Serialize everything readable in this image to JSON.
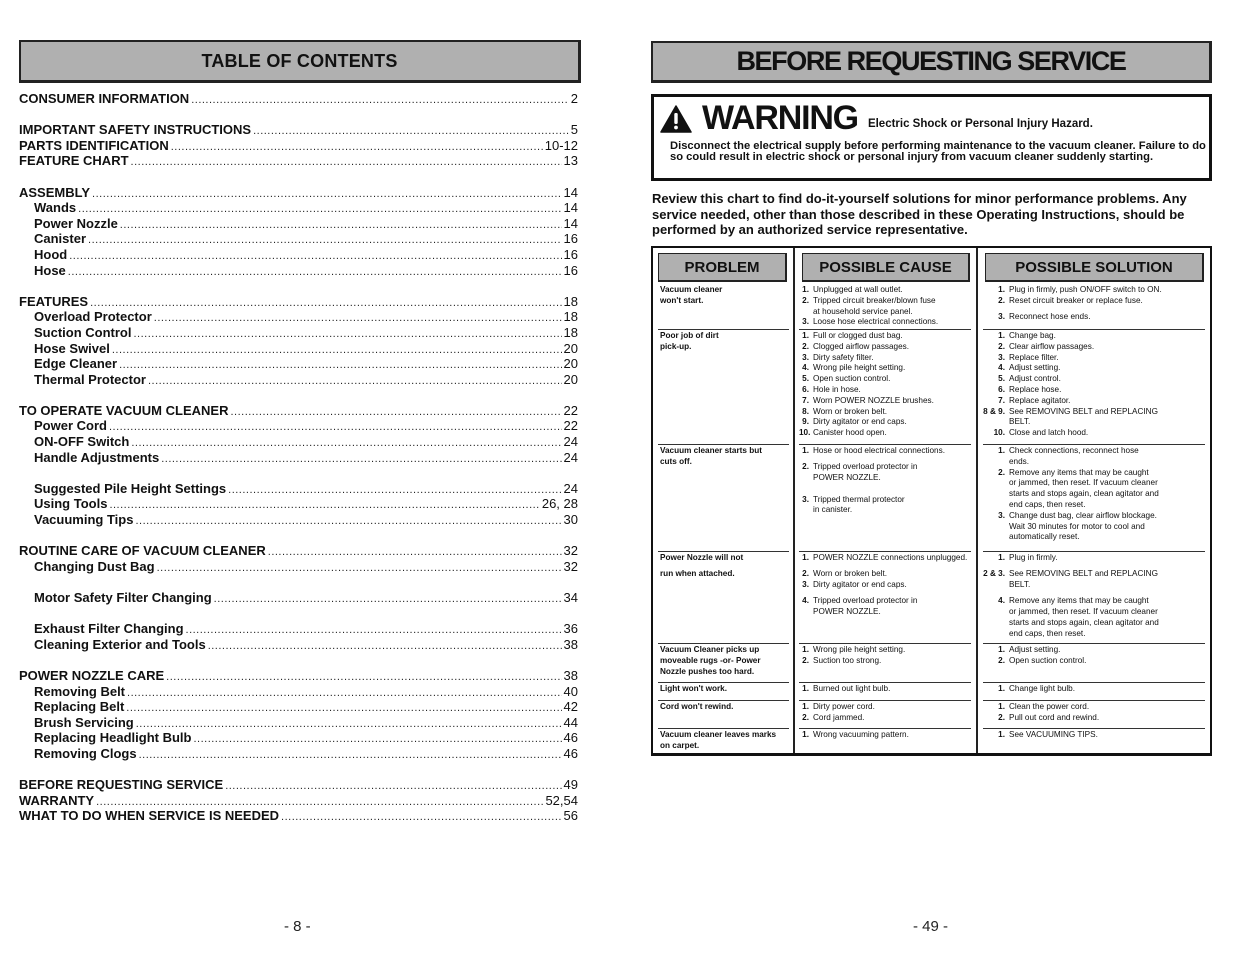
{
  "left_page": {
    "title": "TABLE OF CONTENTS",
    "entries": [
      {
        "label": "CONSUMER INFORMATION",
        "page": "2",
        "level": 0,
        "gap": false
      },
      {
        "label": "IMPORTANT SAFETY INSTRUCTIONS",
        "page": "5",
        "level": 0,
        "gap": true
      },
      {
        "label": "PARTS IDENTIFICATION",
        "page": "10-12",
        "level": 0,
        "gap": false
      },
      {
        "label": "FEATURE CHART",
        "page": "13",
        "level": 0,
        "gap": false
      },
      {
        "label": "ASSEMBLY",
        "page": "14",
        "level": 0,
        "gap": true
      },
      {
        "label": "Wands",
        "page": "14",
        "level": 1,
        "gap": false
      },
      {
        "label": "Power Nozzle",
        "page": "14",
        "level": 1,
        "gap": false
      },
      {
        "label": "Canister",
        "page": "16",
        "level": 1,
        "gap": false
      },
      {
        "label": "Hood",
        "page": "16",
        "level": 1,
        "gap": false
      },
      {
        "label": "Hose",
        "page": "16",
        "level": 1,
        "gap": false
      },
      {
        "label": "FEATURES",
        "page": "18",
        "level": 0,
        "gap": true
      },
      {
        "label": "Overload Protector",
        "page": "18",
        "level": 1,
        "gap": false
      },
      {
        "label": "Suction Control",
        "page": "18",
        "level": 1,
        "gap": false
      },
      {
        "label": "Hose Swivel",
        "page": "20",
        "level": 1,
        "gap": false
      },
      {
        "label": "Edge Cleaner",
        "page": "20",
        "level": 1,
        "gap": false
      },
      {
        "label": "Thermal Protector",
        "page": "20",
        "level": 1,
        "gap": false
      },
      {
        "label": "TO OPERATE VACUUM CLEANER",
        "page": "22",
        "level": 0,
        "gap": true
      },
      {
        "label": "Power Cord",
        "page": "22",
        "level": 1,
        "gap": false
      },
      {
        "label": "ON-OFF Switch",
        "page": "24",
        "level": 1,
        "gap": false
      },
      {
        "label": "Handle Adjustments",
        "page": "24",
        "level": 1,
        "gap": false
      },
      {
        "label": "Suggested Pile Height Settings",
        "page": "24",
        "level": 1,
        "gap": true
      },
      {
        "label": "Using Tools",
        "page": "26, 28",
        "level": 1,
        "gap": false
      },
      {
        "label": "Vacuuming Tips",
        "page": "30",
        "level": 1,
        "gap": false
      },
      {
        "label": "ROUTINE CARE OF VACUUM CLEANER",
        "page": "32",
        "level": 0,
        "gap": true
      },
      {
        "label": "Changing Dust Bag",
        "page": "32",
        "level": 1,
        "gap": false
      },
      {
        "label": "Motor Safety Filter Changing",
        "page": "34",
        "level": 1,
        "gap": true
      },
      {
        "label": "Exhaust Filter Changing",
        "page": "36",
        "level": 1,
        "gap": true
      },
      {
        "label": "Cleaning Exterior and Tools",
        "page": "38",
        "level": 1,
        "gap": false
      },
      {
        "label": "POWER NOZZLE CARE",
        "page": "38",
        "level": 0,
        "gap": true
      },
      {
        "label": "Removing Belt",
        "page": "40",
        "level": 1,
        "gap": false
      },
      {
        "label": "Replacing Belt",
        "page": "42",
        "level": 1,
        "gap": false
      },
      {
        "label": "Brush Servicing",
        "page": "44",
        "level": 1,
        "gap": false
      },
      {
        "label": "Replacing Headlight Bulb",
        "page": "46",
        "level": 1,
        "gap": false
      },
      {
        "label": "Removing Clogs",
        "page": "46",
        "level": 1,
        "gap": false
      },
      {
        "label": "BEFORE REQUESTING SERVICE",
        "page": "49",
        "level": 0,
        "gap": true
      },
      {
        "label": "WARRANTY",
        "page": "52,54",
        "level": 0,
        "gap": false
      },
      {
        "label": "WHAT TO DO WHEN SERVICE IS NEEDED",
        "page": "56",
        "level": 0,
        "gap": false
      }
    ],
    "page_number": "- 8 -"
  },
  "right_page": {
    "title": "BEFORE REQUESTING SERVICE",
    "warning": {
      "icon": "warning-triangle-icon",
      "word": "WARNING",
      "subtitle": "Electric Shock or Personal Injury Hazard.",
      "body": "Disconnect the electrical supply before performing maintenance to the vacuum cleaner. Failure to do so could result in electric shock or personal injury from vacuum cleaner suddenly starting."
    },
    "intro": "Review this chart to find do-it-yourself solutions for minor performance problems. Any service needed, other than those described in these Operating Instructions, should be performed by an authorized service representative.",
    "table": {
      "headers": [
        "PROBLEM",
        "POSSIBLE CAUSE",
        "POSSIBLE SOLUTION"
      ],
      "rows": [
        {
          "problem": [
            "Vacuum cleaner",
            "won't start."
          ],
          "causes": [
            {
              "n": "1.",
              "t": [
                "Unplugged at wall outlet."
              ]
            },
            {
              "n": "2.",
              "t": [
                "Tripped circuit breaker/blown fuse",
                "at household service panel."
              ]
            },
            {
              "n": "3.",
              "t": [
                "Loose hose electrical connections."
              ]
            }
          ],
          "solutions": [
            {
              "n": "1.",
              "t": [
                "Plug in firmly, push ON/OFF switch to ON."
              ]
            },
            {
              "n": "2.",
              "t": [
                "Reset circuit breaker or replace fuse."
              ],
              "after_gap": 1
            },
            {
              "n": "3.",
              "t": [
                "Reconnect hose ends."
              ]
            }
          ]
        },
        {
          "problem": [
            "Poor job of dirt",
            "pick-up."
          ],
          "causes": [
            {
              "n": "1.",
              "t": [
                "Full or clogged dust bag."
              ]
            },
            {
              "n": "2.",
              "t": [
                "Clogged airflow passages."
              ]
            },
            {
              "n": "3.",
              "t": [
                "Dirty safety filter."
              ]
            },
            {
              "n": "4.",
              "t": [
                "Wrong pile height setting."
              ]
            },
            {
              "n": "5.",
              "t": [
                "Open suction control."
              ]
            },
            {
              "n": "6.",
              "t": [
                "Hole in hose."
              ]
            },
            {
              "n": "7.",
              "t": [
                "Worn POWER NOZZLE brushes."
              ]
            },
            {
              "n": "8.",
              "t": [
                "Worn or broken belt."
              ]
            },
            {
              "n": "9.",
              "t": [
                "Dirty agitator or end caps."
              ]
            },
            {
              "n": "10.",
              "t": [
                "Canister hood open."
              ]
            }
          ],
          "solutions": [
            {
              "n": "1.",
              "t": [
                "Change bag."
              ]
            },
            {
              "n": "2.",
              "t": [
                "Clear airflow passages."
              ]
            },
            {
              "n": "3.",
              "t": [
                "Replace filter."
              ]
            },
            {
              "n": "4.",
              "t": [
                "Adjust setting."
              ]
            },
            {
              "n": "5.",
              "t": [
                "Adjust control."
              ]
            },
            {
              "n": "6.",
              "t": [
                "Replace hose."
              ]
            },
            {
              "n": "7.",
              "t": [
                "Replace agitator."
              ]
            },
            {
              "n": "8 & 9.",
              "t": [
                "See REMOVING BELT and REPLACING",
                "BELT."
              ]
            },
            {
              "n": "10.",
              "t": [
                "Close and latch hood."
              ]
            }
          ]
        },
        {
          "problem": [
            "Vacuum cleaner starts but",
            "cuts off."
          ],
          "causes": [
            {
              "n": "1.",
              "t": [
                "Hose or hood electrical connections."
              ],
              "after_gap": 1
            },
            {
              "n": "2.",
              "t": [
                "Tripped overload protector in",
                "POWER NOZZLE."
              ],
              "after_gap": 2
            },
            {
              "n": "3.",
              "t": [
                "Tripped thermal protector",
                "in canister."
              ]
            }
          ],
          "solutions": [
            {
              "n": "1.",
              "t": [
                "Check connections, reconnect hose",
                "ends."
              ]
            },
            {
              "n": "2.",
              "t": [
                "Remove any items that may be caught",
                "or jammed, then reset.  If vacuum cleaner",
                "starts and stops again, clean agitator and",
                "end caps, then reset."
              ]
            },
            {
              "n": "3.",
              "t": [
                "Change dust bag, clear airflow blockage.",
                "Wait 30 minutes for motor to cool and",
                "automatically reset."
              ]
            }
          ]
        },
        {
          "problem": [
            "Power Nozzle will not",
            "",
            "run when attached."
          ],
          "causes": [
            {
              "n": "1.",
              "t": [
                "POWER NOZZLE connections unplugged."
              ],
              "after_gap": 1
            },
            {
              "n": "2.",
              "t": [
                "Worn or broken belt."
              ]
            },
            {
              "n": "3.",
              "t": [
                "Dirty agitator or end caps."
              ],
              "after_gap": 1
            },
            {
              "n": "4.",
              "t": [
                "Tripped overload protector in",
                "POWER NOZZLE."
              ]
            }
          ],
          "solutions": [
            {
              "n": "1.",
              "t": [
                "Plug in firmly."
              ],
              "after_gap": 1
            },
            {
              "n": "2 & 3.",
              "t": [
                "See REMOVING BELT and REPLACING",
                "BELT."
              ],
              "after_gap": 1
            },
            {
              "n": "4.",
              "t": [
                "Remove any items that may be caught",
                "or jammed, then reset.  If vacuum cleaner",
                "starts and stops again, clean agitator and",
                "end caps, then reset."
              ]
            }
          ]
        },
        {
          "problem": [
            "Vacuum Cleaner picks up",
            "moveable rugs -or- Power",
            "Nozzle pushes too hard."
          ],
          "causes": [
            {
              "n": "1.",
              "t": [
                "Wrong pile height setting."
              ]
            },
            {
              "n": "2.",
              "t": [
                "Suction too strong."
              ]
            }
          ],
          "solutions": [
            {
              "n": "1.",
              "t": [
                "Adjust setting."
              ]
            },
            {
              "n": "2.",
              "t": [
                "Open suction control."
              ]
            }
          ]
        },
        {
          "problem": [
            "Light won't work."
          ],
          "causes": [
            {
              "n": "1.",
              "t": [
                "Burned out light bulb."
              ]
            }
          ],
          "solutions": [
            {
              "n": "1.",
              "t": [
                "Change light bulb."
              ]
            }
          ]
        },
        {
          "problem": [
            "Cord won't rewind."
          ],
          "causes": [
            {
              "n": "1.",
              "t": [
                "Dirty power cord."
              ]
            },
            {
              "n": "2.",
              "t": [
                "Cord jammed."
              ]
            }
          ],
          "solutions": [
            {
              "n": "1.",
              "t": [
                "Clean the power cord."
              ]
            },
            {
              "n": "2.",
              "t": [
                "Pull out cord and rewind."
              ]
            }
          ]
        },
        {
          "problem": [
            "Vacuum cleaner leaves marks",
            "on carpet."
          ],
          "causes": [
            {
              "n": "1.",
              "t": [
                "Wrong vacuuming pattern."
              ]
            }
          ],
          "solutions": [
            {
              "n": "1.",
              "t": [
                "See VACUUMING TIPS."
              ]
            }
          ]
        }
      ]
    },
    "page_number": "- 49 -"
  }
}
